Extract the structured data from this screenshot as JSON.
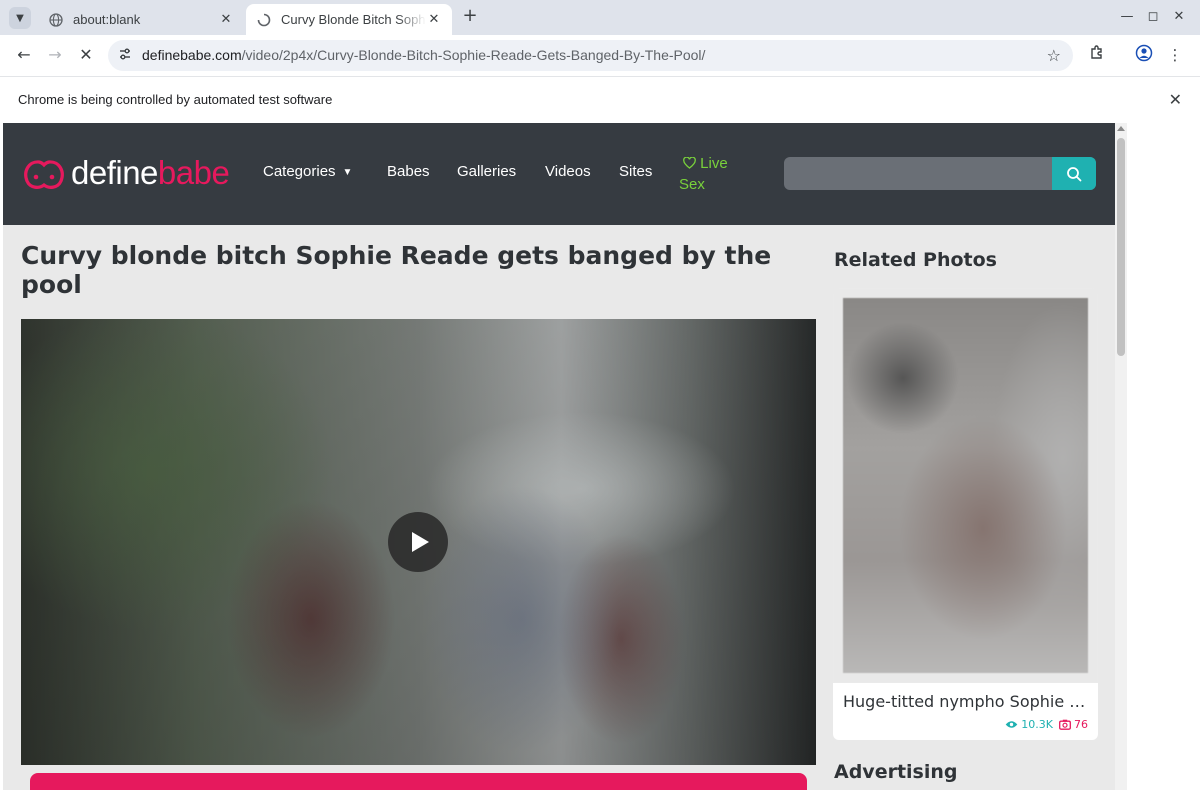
{
  "browser": {
    "tabs": [
      {
        "title": "about:blank",
        "active": false
      },
      {
        "title": "Curvy Blonde Bitch Sophie Reade Gets Banged By The Pool",
        "active": true
      }
    ],
    "url_host": "definebabe.com",
    "url_path": "/video/2p4x/Curvy-Blonde-Bitch-Sophie-Reade-Gets-Banged-By-The-Pool/",
    "infobar_text": "Chrome is being controlled by automated test software"
  },
  "site": {
    "logo_part1": "define",
    "logo_part2": "babe",
    "nav": {
      "categories": "Categories",
      "babes": "Babes",
      "galleries": "Galleries",
      "videos": "Videos",
      "sites": "Sites",
      "live_sex": "Live Sex"
    },
    "search_placeholder": "",
    "colors": {
      "header_bg": "#363b41",
      "brand_pink": "#e6195d",
      "accent_teal": "#1fb1b1",
      "live_green": "#79d13b"
    }
  },
  "main": {
    "title": "Curvy blonde bitch Sophie Reade gets banged by the pool"
  },
  "sidebar": {
    "related_title": "Related Photos",
    "related_item": {
      "caption": "Huge-titted nympho Sophie Reade",
      "views": "10.3K",
      "photos": "76"
    },
    "advertising_title": "Advertising"
  }
}
